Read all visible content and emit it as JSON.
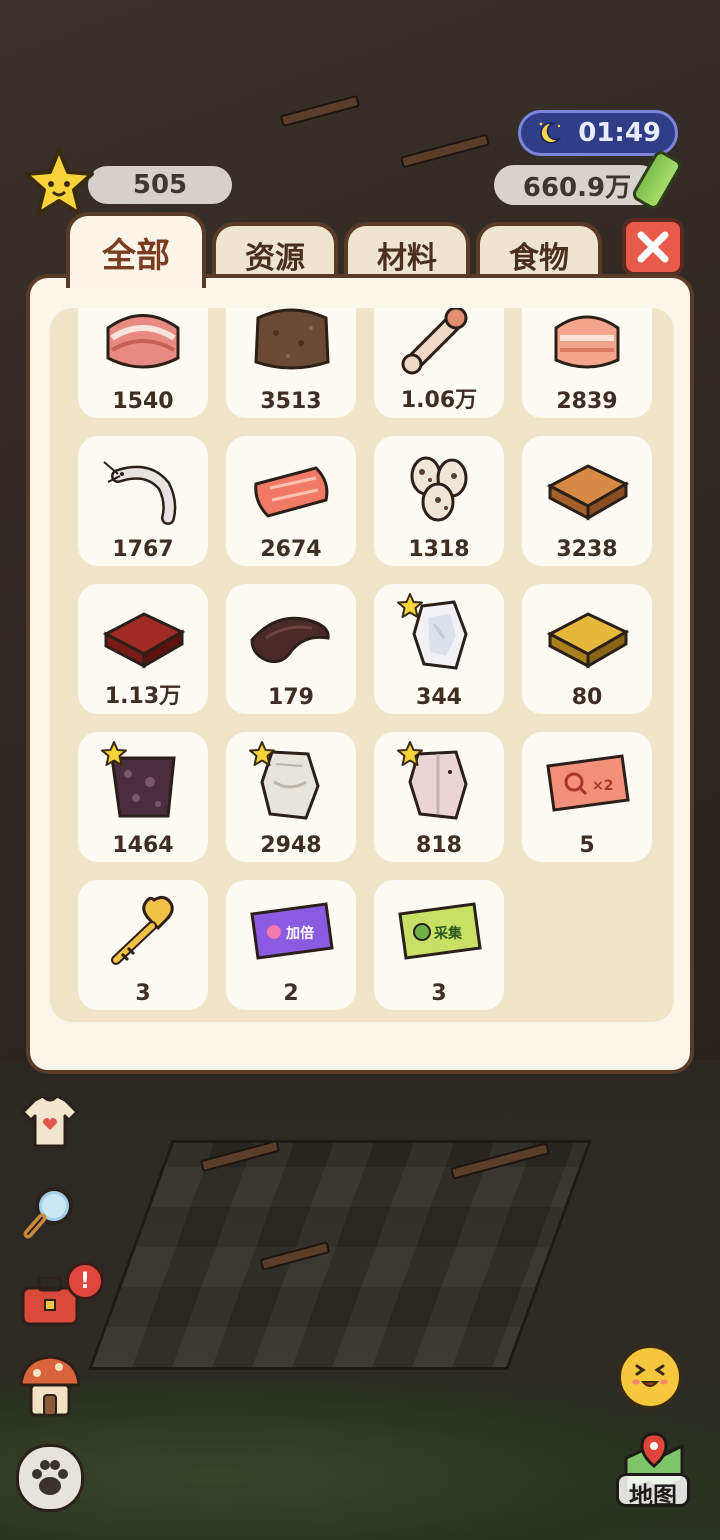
{
  "hud": {
    "time": "01:49",
    "money": "660.9万",
    "stars": "505"
  },
  "tabs": [
    {
      "label": "全部",
      "active": true
    },
    {
      "label": "资源",
      "active": false
    },
    {
      "label": "材料",
      "active": false
    },
    {
      "label": "食物",
      "active": false
    }
  ],
  "items": [
    {
      "icon": "raw-meat-icon",
      "count": "1540"
    },
    {
      "icon": "soil-clump-icon",
      "count": "3513"
    },
    {
      "icon": "bone-icon",
      "count": "1.06万"
    },
    {
      "icon": "pork-belly-icon",
      "count": "2839"
    },
    {
      "icon": "shrimp-icon",
      "count": "1767"
    },
    {
      "icon": "salmon-fillet-icon",
      "count": "2674"
    },
    {
      "icon": "quail-eggs-icon",
      "count": "1318"
    },
    {
      "icon": "wood-plank-icon",
      "count": "3238"
    },
    {
      "icon": "red-wood-block-icon",
      "count": "1.13万"
    },
    {
      "icon": "dark-wood-icon",
      "count": "179"
    },
    {
      "icon": "white-crystal-icon",
      "count": "344",
      "starred": true
    },
    {
      "icon": "gold-bar-icon",
      "count": "80"
    },
    {
      "icon": "purple-ore-icon",
      "count": "1464",
      "starred": true
    },
    {
      "icon": "white-stone-icon",
      "count": "2948",
      "starred": true
    },
    {
      "icon": "pink-stone-icon",
      "count": "818",
      "starred": true
    },
    {
      "icon": "search-x2-ticket-icon",
      "count": "5",
      "ticket_text": "×2"
    },
    {
      "icon": "heart-key-icon",
      "count": "3"
    },
    {
      "icon": "double-ticket-icon",
      "count": "2",
      "ticket_text": "加倍"
    },
    {
      "icon": "gather-ticket-icon",
      "count": "3",
      "ticket_text": "采集"
    }
  ],
  "side": {
    "alert": "!",
    "map_label": "地图"
  },
  "colors": {
    "panel_bg": "#fbf6ea",
    "panel_border": "#5a3b28",
    "inner_bg": "#f1e5c9",
    "close_red": "#e85a4a",
    "time_blue": "#2f3e86"
  }
}
